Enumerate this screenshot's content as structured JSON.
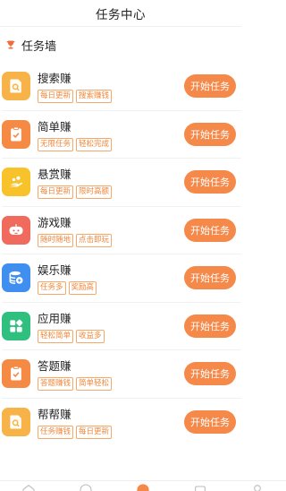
{
  "header": {
    "title": "任务中心"
  },
  "section": {
    "title": "任务墙"
  },
  "tasks": [
    {
      "name": "搜索赚",
      "tags": [
        "每日更新",
        "搜索赚钱"
      ],
      "button": "开始任务",
      "icon": "search-doc-icon",
      "color": "#f7b347"
    },
    {
      "name": "简单赚",
      "tags": [
        "无限任务",
        "轻松完成"
      ],
      "button": "开始任务",
      "icon": "clipboard-check-icon",
      "color": "#f58a45"
    },
    {
      "name": "悬赏赚",
      "tags": [
        "每日更新",
        "限时高额"
      ],
      "button": "开始任务",
      "icon": "hand-coins-icon",
      "color": "#f8c22a"
    },
    {
      "name": "游戏赚",
      "tags": [
        "随时随地",
        "点击即玩"
      ],
      "button": "开始任务",
      "icon": "gamepad-icon",
      "color": "#f06a5e"
    },
    {
      "name": "娱乐赚",
      "tags": [
        "任务多",
        "奖励高"
      ],
      "button": "开始任务",
      "icon": "coin-stack-icon",
      "color": "#3f8ff0"
    },
    {
      "name": "应用赚",
      "tags": [
        "轻松简单",
        "收益多"
      ],
      "button": "开始任务",
      "icon": "apps-grid-icon",
      "color": "#2fbf7f"
    },
    {
      "name": "答题赚",
      "tags": [
        "答题赚钱",
        "简单轻松"
      ],
      "button": "开始任务",
      "icon": "clipboard-check-icon",
      "color": "#f58a45"
    },
    {
      "name": "帮帮赚",
      "tags": [
        "任务赚钱",
        "每日更新"
      ],
      "button": "开始任务",
      "icon": "search-doc-icon",
      "color": "#f7b347"
    }
  ],
  "tabbar": [
    "home-icon",
    "task-icon",
    "center-icon",
    "shop-icon",
    "profile-icon"
  ]
}
